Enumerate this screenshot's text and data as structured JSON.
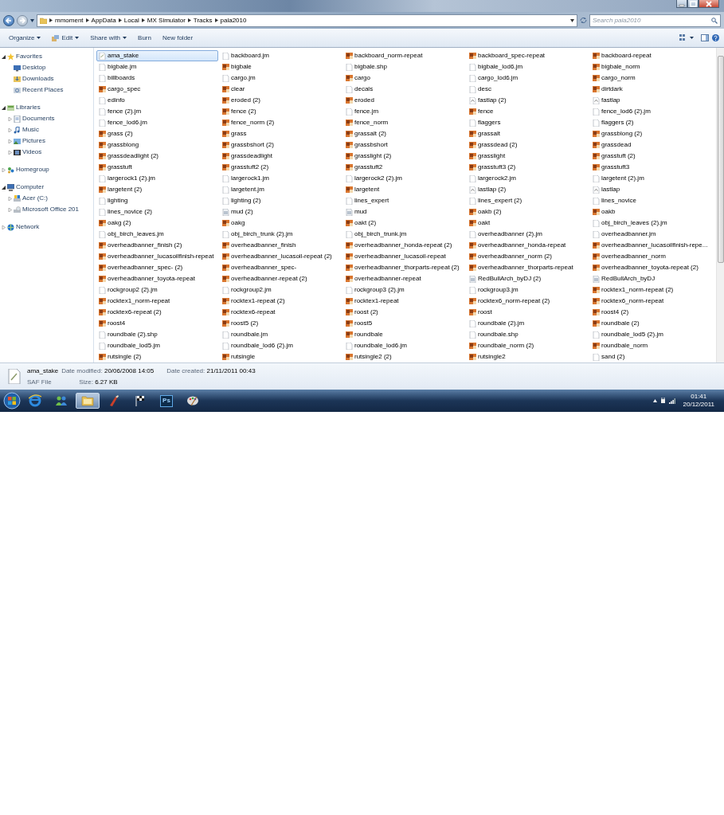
{
  "address": {
    "crumbs": [
      "mmoment",
      "AppData",
      "Local",
      "MX Simulator",
      "Tracks",
      "pala2010"
    ]
  },
  "search": {
    "placeholder": "Search pala2010"
  },
  "toolbar": [
    {
      "label": "Organize",
      "menu": true,
      "kind": "plain"
    },
    {
      "label": "Edit",
      "menu": true,
      "kind": "edit"
    },
    {
      "label": "Share with",
      "menu": true,
      "kind": "plain"
    },
    {
      "label": "Burn",
      "menu": false,
      "kind": "plain"
    },
    {
      "label": "New folder",
      "menu": false,
      "kind": "plain"
    }
  ],
  "sidebar": {
    "items": [
      {
        "label": "Favorites",
        "kind": "star",
        "expanded": true,
        "children": [
          {
            "label": "Desktop",
            "kind": "desktop"
          },
          {
            "label": "Downloads",
            "kind": "download"
          },
          {
            "label": "Recent Places",
            "kind": "recent"
          }
        ]
      },
      {
        "label": "Libraries",
        "kind": "library",
        "expanded": true,
        "children": [
          {
            "label": "Documents",
            "kind": "document",
            "expanded": false
          },
          {
            "label": "Music",
            "kind": "music",
            "expanded": false
          },
          {
            "label": "Pictures",
            "kind": "picture",
            "expanded": false
          },
          {
            "label": "Videos",
            "kind": "video",
            "expanded": false
          }
        ]
      },
      {
        "label": "Homegroup",
        "kind": "homegroup",
        "expanded": false
      },
      {
        "label": "Computer",
        "kind": "computer",
        "expanded": true,
        "children": [
          {
            "label": "Acer (C:)",
            "kind": "drive",
            "expanded": false
          },
          {
            "label": "Microsoft Office 201",
            "kind": "disc",
            "expanded": false
          }
        ]
      },
      {
        "label": "Network",
        "kind": "network",
        "expanded": false
      }
    ]
  },
  "files": [
    {
      "name": "ama_stake",
      "kind": "saf",
      "selected": true
    },
    {
      "name": "backboard.jm",
      "kind": "file",
      "selected": false
    },
    {
      "name": "backboard_norm-repeat",
      "kind": "image",
      "selected": false
    },
    {
      "name": "backboard_spec-repeat",
      "kind": "image",
      "selected": false
    },
    {
      "name": "backboard-repeat",
      "kind": "image",
      "selected": false
    },
    {
      "name": "bigbale.jm",
      "kind": "file",
      "selected": false
    },
    {
      "name": "bigbale",
      "kind": "image",
      "selected": false
    },
    {
      "name": "bigbale.shp",
      "kind": "file",
      "selected": false
    },
    {
      "name": "bigbale_lod6.jm",
      "kind": "file",
      "selected": false
    },
    {
      "name": "bigbale_norm",
      "kind": "image",
      "selected": false
    },
    {
      "name": "billboards",
      "kind": "file",
      "selected": false
    },
    {
      "name": "cargo.jm",
      "kind": "file",
      "selected": false
    },
    {
      "name": "cargo",
      "kind": "image",
      "selected": false
    },
    {
      "name": "cargo_lod6.jm",
      "kind": "file",
      "selected": false
    },
    {
      "name": "cargo_norm",
      "kind": "image",
      "selected": false
    },
    {
      "name": "cargo_spec",
      "kind": "image",
      "selected": false
    },
    {
      "name": "clear",
      "kind": "image",
      "selected": false
    },
    {
      "name": "decals",
      "kind": "file",
      "selected": false
    },
    {
      "name": "desc",
      "kind": "file",
      "selected": false
    },
    {
      "name": "dirtdark",
      "kind": "image",
      "selected": false
    },
    {
      "name": "edinfo",
      "kind": "file",
      "selected": false
    },
    {
      "name": "eroded (2)",
      "kind": "image",
      "selected": false
    },
    {
      "name": "eroded",
      "kind": "image",
      "selected": false
    },
    {
      "name": "fastlap (2)",
      "kind": "lap",
      "selected": false
    },
    {
      "name": "fastlap",
      "kind": "lap",
      "selected": false
    },
    {
      "name": "fence (2).jm",
      "kind": "file",
      "selected": false
    },
    {
      "name": "fence (2)",
      "kind": "image",
      "selected": false
    },
    {
      "name": "fence.jm",
      "kind": "file",
      "selected": false
    },
    {
      "name": "fence",
      "kind": "image",
      "selected": false
    },
    {
      "name": "fence_lod6 (2).jm",
      "kind": "file",
      "selected": false
    },
    {
      "name": "fence_lod6.jm",
      "kind": "file",
      "selected": false
    },
    {
      "name": "fence_norm (2)",
      "kind": "image",
      "selected": false
    },
    {
      "name": "fence_norm",
      "kind": "image",
      "selected": false
    },
    {
      "name": "flaggers",
      "kind": "file",
      "selected": false
    },
    {
      "name": "flaggers (2)",
      "kind": "file",
      "selected": false
    },
    {
      "name": "grass (2)",
      "kind": "image",
      "selected": false
    },
    {
      "name": "grass",
      "kind": "image",
      "selected": false
    },
    {
      "name": "grassalt (2)",
      "kind": "image",
      "selected": false
    },
    {
      "name": "grassalt",
      "kind": "image",
      "selected": false
    },
    {
      "name": "grassblong (2)",
      "kind": "image",
      "selected": false
    },
    {
      "name": "grassblong",
      "kind": "image",
      "selected": false
    },
    {
      "name": "grassbshort (2)",
      "kind": "image",
      "selected": false
    },
    {
      "name": "grassbshort",
      "kind": "image",
      "selected": false
    },
    {
      "name": "grassdead (2)",
      "kind": "image",
      "selected": false
    },
    {
      "name": "grassdead",
      "kind": "image",
      "selected": false
    },
    {
      "name": "grassdeadlight (2)",
      "kind": "image",
      "selected": false
    },
    {
      "name": "grassdeadlight",
      "kind": "image",
      "selected": false
    },
    {
      "name": "grasslight (2)",
      "kind": "image",
      "selected": false
    },
    {
      "name": "grasslight",
      "kind": "image",
      "selected": false
    },
    {
      "name": "grasstuft (2)",
      "kind": "image",
      "selected": false
    },
    {
      "name": "grasstuft",
      "kind": "image",
      "selected": false
    },
    {
      "name": "grasstuft2 (2)",
      "kind": "image",
      "selected": false
    },
    {
      "name": "grasstuft2",
      "kind": "image",
      "selected": false
    },
    {
      "name": "grasstuft3 (2)",
      "kind": "image",
      "selected": false
    },
    {
      "name": "grasstuft3",
      "kind": "image",
      "selected": false
    },
    {
      "name": "largerock1 (2).jm",
      "kind": "file",
      "selected": false
    },
    {
      "name": "largerock1.jm",
      "kind": "file",
      "selected": false
    },
    {
      "name": "largerock2 (2).jm",
      "kind": "file",
      "selected": false
    },
    {
      "name": "largerock2.jm",
      "kind": "file",
      "selected": false
    },
    {
      "name": "largetent (2).jm",
      "kind": "file",
      "selected": false
    },
    {
      "name": "largetent (2)",
      "kind": "image",
      "selected": false
    },
    {
      "name": "largetent.jm",
      "kind": "file",
      "selected": false
    },
    {
      "name": "largetent",
      "kind": "image",
      "selected": false
    },
    {
      "name": "lastlap (2)",
      "kind": "lap",
      "selected": false
    },
    {
      "name": "lastlap",
      "kind": "lap",
      "selected": false
    },
    {
      "name": "lighting",
      "kind": "file",
      "selected": false
    },
    {
      "name": "lighting (2)",
      "kind": "file",
      "selected": false
    },
    {
      "name": "lines_expert",
      "kind": "file",
      "selected": false
    },
    {
      "name": "lines_expert (2)",
      "kind": "file",
      "selected": false
    },
    {
      "name": "lines_novice",
      "kind": "file",
      "selected": false
    },
    {
      "name": "lines_novice (2)",
      "kind": "file",
      "selected": false
    },
    {
      "name": "mud (2)",
      "kind": "picture",
      "selected": false
    },
    {
      "name": "mud",
      "kind": "picture",
      "selected": false
    },
    {
      "name": "oakb (2)",
      "kind": "image",
      "selected": false
    },
    {
      "name": "oakb",
      "kind": "image",
      "selected": false
    },
    {
      "name": "oakg (2)",
      "kind": "image",
      "selected": false
    },
    {
      "name": "oakg",
      "kind": "image",
      "selected": false
    },
    {
      "name": "oakt (2)",
      "kind": "image",
      "selected": false
    },
    {
      "name": "oakt",
      "kind": "image",
      "selected": false
    },
    {
      "name": "obj_birch_leaves (2).jm",
      "kind": "file",
      "selected": false
    },
    {
      "name": "obj_birch_leaves.jm",
      "kind": "file",
      "selected": false
    },
    {
      "name": "obj_birch_trunk (2).jm",
      "kind": "file",
      "selected": false
    },
    {
      "name": "obj_birch_trunk.jm",
      "kind": "file",
      "selected": false
    },
    {
      "name": "overheadbanner (2).jm",
      "kind": "file",
      "selected": false
    },
    {
      "name": "overheadbanner.jm",
      "kind": "file",
      "selected": false
    },
    {
      "name": "overheadbanner_finish (2)",
      "kind": "image",
      "selected": false
    },
    {
      "name": "overheadbanner_finish",
      "kind": "image",
      "selected": false
    },
    {
      "name": "overheadbanner_honda-repeat (2)",
      "kind": "image",
      "selected": false
    },
    {
      "name": "overheadbanner_honda-repeat",
      "kind": "image",
      "selected": false
    },
    {
      "name": "overheadbanner_lucasoilfinish-repe...",
      "kind": "image",
      "selected": false
    },
    {
      "name": "overheadbanner_lucasoilfinish-repeat",
      "kind": "image",
      "selected": false
    },
    {
      "name": "overheadbanner_lucasoil-repeat (2)",
      "kind": "image",
      "selected": false
    },
    {
      "name": "overheadbanner_lucasoil-repeat",
      "kind": "image",
      "selected": false
    },
    {
      "name": "overheadbanner_norm (2)",
      "kind": "image",
      "selected": false
    },
    {
      "name": "overheadbanner_norm",
      "kind": "image",
      "selected": false
    },
    {
      "name": "overheadbanner_spec- (2)",
      "kind": "image",
      "selected": false
    },
    {
      "name": "overheadbanner_spec-",
      "kind": "image",
      "selected": false
    },
    {
      "name": "overheadbanner_thorparts-repeat (2)",
      "kind": "image",
      "selected": false
    },
    {
      "name": "overheadbanner_thorparts-repeat",
      "kind": "image",
      "selected": false
    },
    {
      "name": "overheadbanner_toyota-repeat (2)",
      "kind": "image",
      "selected": false
    },
    {
      "name": "overheadbanner_toyota-repeat",
      "kind": "image",
      "selected": false
    },
    {
      "name": "overheadbanner-repeat (2)",
      "kind": "image",
      "selected": false
    },
    {
      "name": "overheadbanner-repeat",
      "kind": "image",
      "selected": false
    },
    {
      "name": "RedBullArch_byDJ (2)",
      "kind": "picture",
      "selected": false
    },
    {
      "name": "RedBullArch_byDJ",
      "kind": "picture",
      "selected": false
    },
    {
      "name": "rockgroup2 (2).jm",
      "kind": "file",
      "selected": false
    },
    {
      "name": "rockgroup2.jm",
      "kind": "file",
      "selected": false
    },
    {
      "name": "rockgroup3 (2).jm",
      "kind": "file",
      "selected": false
    },
    {
      "name": "rockgroup3.jm",
      "kind": "file",
      "selected": false
    },
    {
      "name": "rocktex1_norm-repeat (2)",
      "kind": "image",
      "selected": false
    },
    {
      "name": "rocktex1_norm-repeat",
      "kind": "image",
      "selected": false
    },
    {
      "name": "rocktex1-repeat (2)",
      "kind": "image",
      "selected": false
    },
    {
      "name": "rocktex1-repeat",
      "kind": "image",
      "selected": false
    },
    {
      "name": "rocktex6_norm-repeat (2)",
      "kind": "image",
      "selected": false
    },
    {
      "name": "rocktex6_norm-repeat",
      "kind": "image",
      "selected": false
    },
    {
      "name": "rocktex6-repeat (2)",
      "kind": "image",
      "selected": false
    },
    {
      "name": "rocktex6-repeat",
      "kind": "image",
      "selected": false
    },
    {
      "name": "roost (2)",
      "kind": "image",
      "selected": false
    },
    {
      "name": "roost",
      "kind": "image",
      "selected": false
    },
    {
      "name": "roost4 (2)",
      "kind": "image",
      "selected": false
    },
    {
      "name": "roost4",
      "kind": "image",
      "selected": false
    },
    {
      "name": "roost5 (2)",
      "kind": "image",
      "selected": false
    },
    {
      "name": "roost5",
      "kind": "image",
      "selected": false
    },
    {
      "name": "roundbale (2).jm",
      "kind": "file",
      "selected": false
    },
    {
      "name": "roundbale (2)",
      "kind": "image",
      "selected": false
    },
    {
      "name": "roundbale (2).shp",
      "kind": "file",
      "selected": false
    },
    {
      "name": "roundbale.jm",
      "kind": "file",
      "selected": false
    },
    {
      "name": "roundbale",
      "kind": "image",
      "selected": false
    },
    {
      "name": "roundbale.shp",
      "kind": "file",
      "selected": false
    },
    {
      "name": "roundbale_lod5 (2).jm",
      "kind": "file",
      "selected": false
    },
    {
      "name": "roundbale_lod5.jm",
      "kind": "file",
      "selected": false
    },
    {
      "name": "roundbale_lod6 (2).jm",
      "kind": "file",
      "selected": false
    },
    {
      "name": "roundbale_lod6.jm",
      "kind": "file",
      "selected": false
    },
    {
      "name": "roundbale_norm (2)",
      "kind": "image",
      "selected": false
    },
    {
      "name": "roundbale_norm",
      "kind": "image",
      "selected": false
    },
    {
      "name": "rutsingle (2)",
      "kind": "image",
      "selected": false
    },
    {
      "name": "rutsingle",
      "kind": "image",
      "selected": false
    },
    {
      "name": "rutsingle2 (2)",
      "kind": "image",
      "selected": false
    },
    {
      "name": "rutsingle2",
      "kind": "image",
      "selected": false
    },
    {
      "name": "sand (2)",
      "kind": "file",
      "selected": false
    }
  ],
  "details": {
    "name": "ama_stake",
    "type": "SAF File",
    "fields": [
      {
        "label": "Date modified:",
        "value": "20/06/2008 14:05"
      },
      {
        "label": "Date created:",
        "value": "21/11/2011 00:43"
      },
      {
        "label": "Size:",
        "value": "6.27 KB"
      }
    ]
  },
  "taskbar": {
    "apps": [
      {
        "kind": "ie",
        "active": false
      },
      {
        "kind": "people",
        "active": false
      },
      {
        "kind": "folder",
        "active": true
      },
      {
        "kind": "brush",
        "active": false
      },
      {
        "kind": "flag",
        "active": false
      },
      {
        "kind": "ps",
        "label": "Ps",
        "active": false
      },
      {
        "kind": "palette",
        "active": false
      }
    ],
    "time": "01:41",
    "date": "20/12/2011"
  }
}
